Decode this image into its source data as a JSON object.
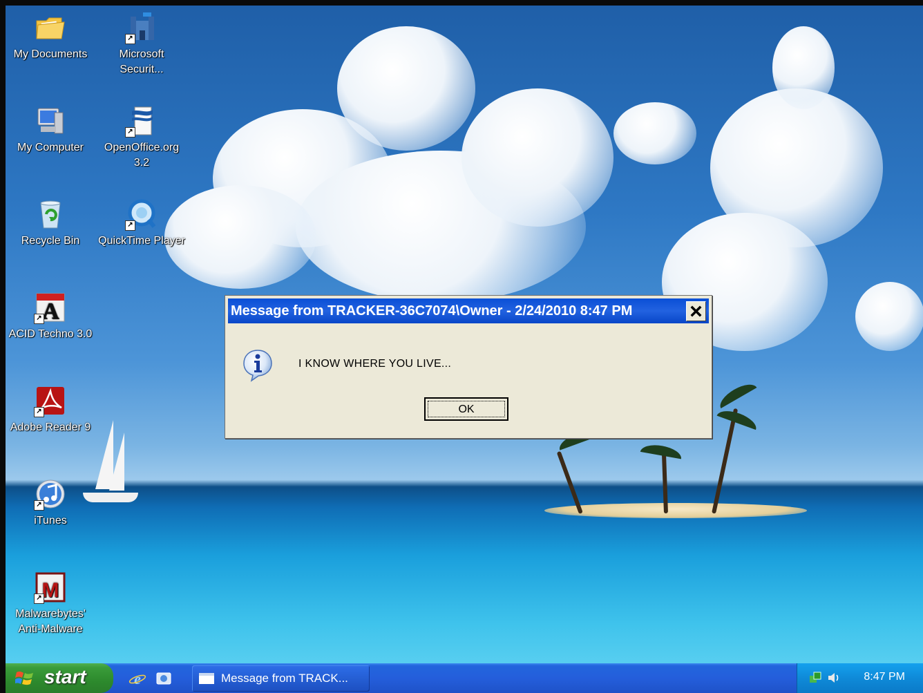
{
  "desktop": {
    "icons": [
      {
        "label": "My Documents"
      },
      {
        "label": "Microsoft Securit..."
      },
      {
        "label": "My Computer"
      },
      {
        "label": "OpenOffice.org 3.2"
      },
      {
        "label": "Recycle Bin"
      },
      {
        "label": "QuickTime Player"
      },
      {
        "label": "ACID Techno 3.0"
      },
      {
        "label": "Adobe Reader 9"
      },
      {
        "label": "iTunes"
      },
      {
        "label": "Malwarebytes' Anti-Malware"
      }
    ]
  },
  "dialog": {
    "title": "Message from TRACKER-36C7074\\Owner - 2/24/2010 8:47 PM",
    "message": "I KNOW WHERE YOU LIVE...",
    "ok_label": "OK",
    "icon": "info-icon"
  },
  "taskbar": {
    "start_label": "start",
    "quick_launch": [
      "internet-explorer-icon",
      "desktop-icon"
    ],
    "task_label": "Message from TRACK...",
    "clock": "8:47 PM",
    "tray_icons": [
      "network-icon",
      "volume-icon"
    ]
  },
  "colors": {
    "titlebar": "#0a4fd6",
    "taskbar": "#245edb",
    "start": "#3a9c3a",
    "dialog_bg": "#ece9d8"
  }
}
